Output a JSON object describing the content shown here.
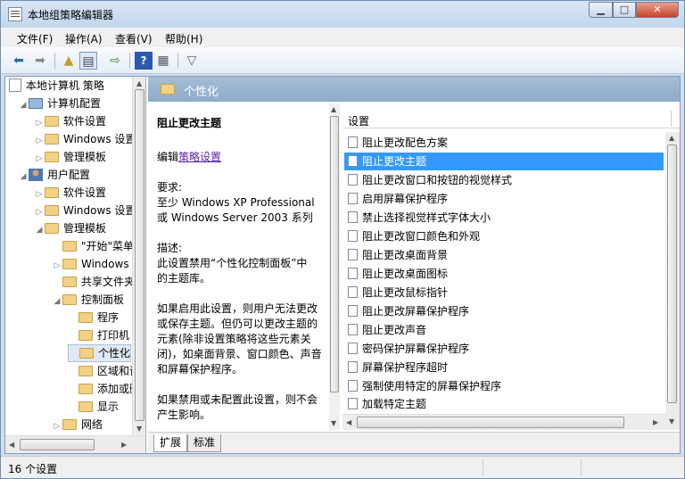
{
  "window": {
    "title": "本地组策略编辑器"
  },
  "menu": [
    "文件(F)",
    "操作(A)",
    "查看(V)",
    "帮助(H)"
  ],
  "toolbar": {
    "icons": [
      "back-icon",
      "forward-icon",
      "up-icon",
      "show-hide-tree-icon",
      "export-icon",
      "help-icon",
      "filter-view-icon",
      "filter-icon"
    ]
  },
  "tree": [
    {
      "label": "本地计算机 策略",
      "icon": "policy"
    },
    {
      "label": "计算机配置",
      "icon": "computer"
    },
    {
      "label": "软件设置",
      "icon": "folder"
    },
    {
      "label": "Windows 设置",
      "icon": "folder"
    },
    {
      "label": "管理模板",
      "icon": "folder"
    },
    {
      "label": "用户配置",
      "icon": "user"
    },
    {
      "label": "软件设置",
      "icon": "folder"
    },
    {
      "label": "Windows 设置",
      "icon": "folder"
    },
    {
      "label": "管理模板",
      "icon": "folder"
    },
    {
      "label": "\"开始\"菜单和任务栏",
      "icon": "folder"
    },
    {
      "label": "Windows 组件",
      "icon": "folder"
    },
    {
      "label": "共享文件夹",
      "icon": "folder"
    },
    {
      "label": "控制面板",
      "icon": "folder"
    },
    {
      "label": "程序",
      "icon": "folder"
    },
    {
      "label": "打印机",
      "icon": "folder"
    },
    {
      "label": "个性化",
      "icon": "folder"
    },
    {
      "label": "区域和语言选项",
      "icon": "folder"
    },
    {
      "label": "添加或删除程序",
      "icon": "folder"
    },
    {
      "label": "显示",
      "icon": "folder"
    },
    {
      "label": "网络",
      "icon": "folder"
    }
  ],
  "header": {
    "title": "个性化"
  },
  "description": {
    "title": "阻止更改主题",
    "edit_prefix": "编辑",
    "edit_link": "策略设置",
    "req_label": "要求:",
    "req_line1": "至少 Windows XP Professional",
    "req_line2": "或 Windows Server 2003 系列",
    "desc_label": "描述:",
    "desc_line1": "此设置禁用“个性化控制面板”中",
    "desc_line2": "的主题库。",
    "enabled_1": "如果启用此设置，则用户无法更改",
    "enabled_2": "或保存主题。但仍可以更改主题的",
    "enabled_3": "元素(除非设置策略将这些元素关",
    "enabled_4": "闭)，如桌面背景、窗口颜色、声音",
    "enabled_5": "和屏幕保护程序。",
    "disabled_1": "如果禁用或未配置此设置，则不会",
    "disabled_2": "产生影响。"
  },
  "list": {
    "column": "设置",
    "items": [
      "阻止更改配色方案",
      "阻止更改主题",
      "阻止更改窗口和按钮的视觉样式",
      "启用屏幕保护程序",
      "禁止选择视觉样式字体大小",
      "阻止更改窗口颜色和外观",
      "阻止更改桌面背景",
      "阻止更改桌面图标",
      "阻止更改鼠标指针",
      "阻止更改屏幕保护程序",
      "阻止更改声音",
      "密码保护屏幕保护程序",
      "屏幕保护程序超时",
      "强制使用特定的屏幕保护程序",
      "加载特定主题"
    ],
    "selected_index": 1
  },
  "tabs": [
    "扩展",
    "标准"
  ],
  "status": "16 个设置",
  "colors": {
    "selection": "#3399ff",
    "header": "#98b3cf"
  }
}
